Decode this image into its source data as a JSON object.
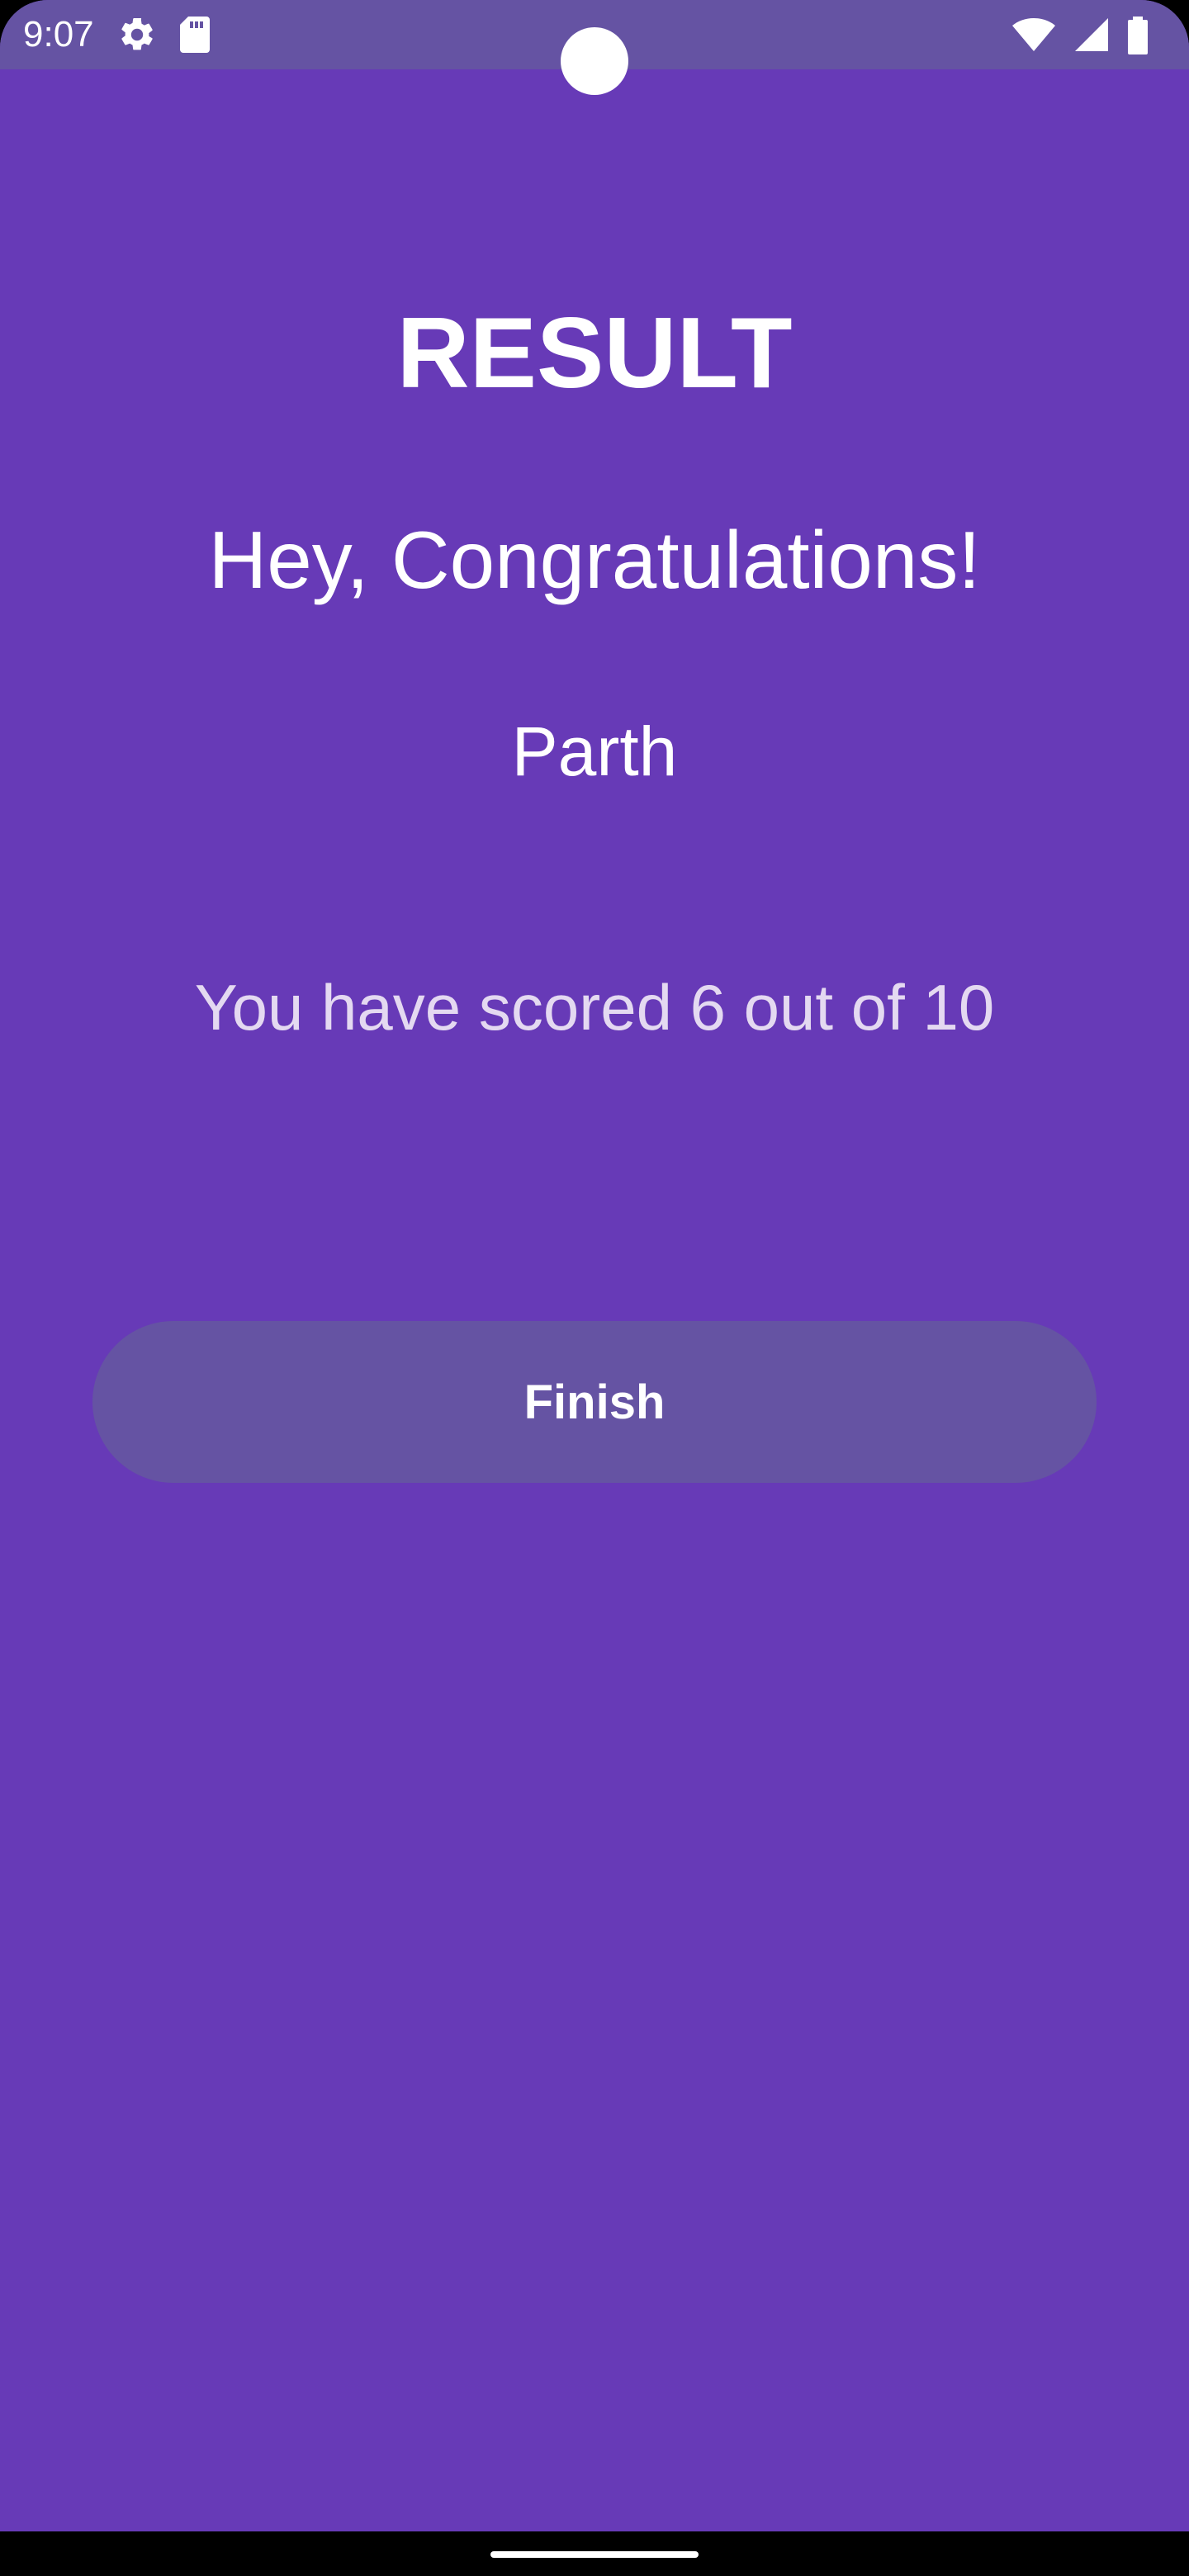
{
  "status_bar": {
    "time": "9:07",
    "icons_left": [
      "gear-icon",
      "sd-card-icon"
    ],
    "icons_right": [
      "wifi-icon",
      "cellular-signal-icon",
      "battery-icon"
    ],
    "background_color": "#6553A3"
  },
  "result": {
    "title": "RESULT",
    "congrats": "Hey, Congratulations!",
    "user_name": "Parth",
    "score_text": "You have scored 6 out of 10",
    "finish_label": "Finish"
  },
  "colors": {
    "background": "#673AB7",
    "button": "#6553A3",
    "text_primary": "#FFFFFF",
    "text_secondary": "#E4D9F1"
  }
}
